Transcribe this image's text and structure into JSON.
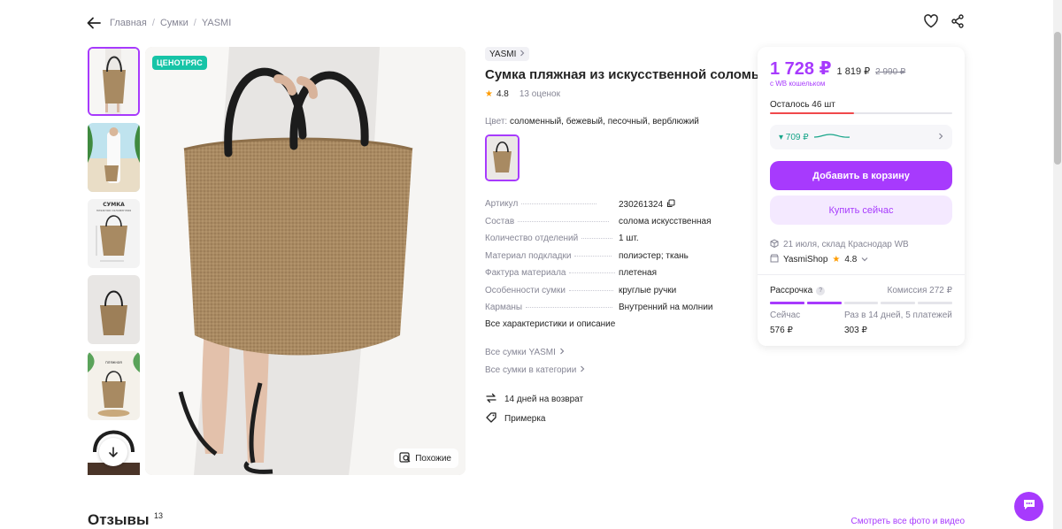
{
  "breadcrumbs": [
    "Главная",
    "Сумки",
    "YASMI"
  ],
  "main_image": {
    "promo_badge": "ЦЕНОТРЯС",
    "similar_label": "Похожие"
  },
  "product": {
    "brand": "YASMI",
    "title": "Сумка пляжная из искусственной соломы",
    "rating": "4.8",
    "reviews_count_label": "13 оценок",
    "color_label": "Цвет:",
    "color_value": "соломенный, бежевый, песочный, верблюжий"
  },
  "specs": [
    {
      "key": "Артикул",
      "value": "230261324"
    },
    {
      "key": "Состав",
      "value": "солома искусственная"
    },
    {
      "key": "Количество отделений",
      "value": "1 шт."
    },
    {
      "key": "Материал подкладки",
      "value": "полиэстер; ткань"
    },
    {
      "key": "Фактура материала",
      "value": "плетеная"
    },
    {
      "key": "Особенности сумки",
      "value": "круглые ручки"
    },
    {
      "key": "Карманы",
      "value": "Внутренний на молнии"
    }
  ],
  "all_specs_link": "Все характеристики и описание",
  "links": {
    "brand_all": "Все сумки YASMI",
    "category_all": "Все сумки в категории"
  },
  "features": {
    "return": "14 дней на возврат",
    "fitting": "Примерка"
  },
  "card": {
    "price": "1 728 ₽",
    "price_no_wallet": "1 819 ₽",
    "price_old": "2 990 ₽",
    "wallet_note": "с WB кошельком",
    "stock_text": "Осталось 46 шт",
    "stock_fraction": 0.46,
    "installment_price": "▾ 709 ₽",
    "add_to_cart": "Добавить в корзину",
    "buy_now": "Купить сейчас",
    "delivery": "21 июля, склад Краснодар WB",
    "seller_name": "YasmiShop",
    "seller_rating": "4.8",
    "installments_tab": "Рассрочка",
    "commission": "Комиссия 272 ₽",
    "now_label": "Сейчас",
    "now_value": "576 ₽",
    "schedule_label": "Раз в 14 дней, 5 платежей",
    "schedule_value": "303 ₽"
  },
  "reviews": {
    "title": "Отзывы",
    "count": "13",
    "see_all": "Смотреть все фото и видео"
  },
  "colors": {
    "accent": "#a73afd",
    "badge": "#17c4a7",
    "star": "#ff9c00",
    "stock": "#f0484b"
  }
}
